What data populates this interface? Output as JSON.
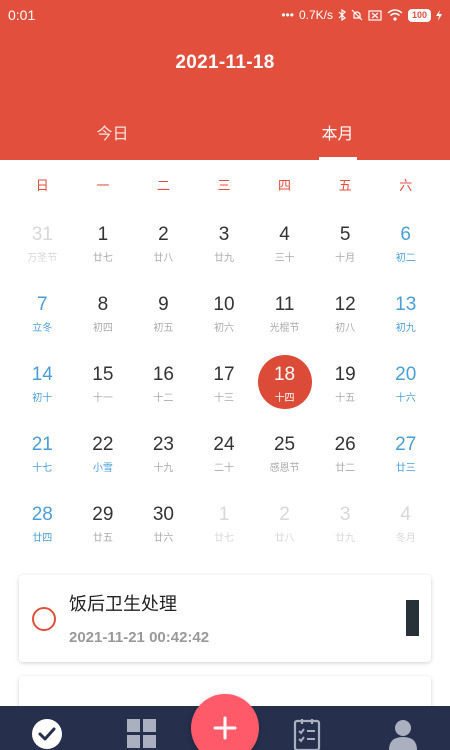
{
  "status_bar": {
    "time": "0:01",
    "network_speed": "0.7K/s",
    "battery": "100"
  },
  "header": {
    "date": "2021-11-18",
    "tabs": [
      {
        "label": "今日",
        "active": false
      },
      {
        "label": "本月",
        "active": true
      }
    ]
  },
  "calendar": {
    "weekdays": [
      "日",
      "一",
      "二",
      "三",
      "四",
      "五",
      "六"
    ],
    "days": [
      {
        "num": "31",
        "sub": "万圣节",
        "kind": "other"
      },
      {
        "num": "1",
        "sub": "廿七",
        "kind": "normal"
      },
      {
        "num": "2",
        "sub": "廿八",
        "kind": "normal"
      },
      {
        "num": "3",
        "sub": "廿九",
        "kind": "normal"
      },
      {
        "num": "4",
        "sub": "三十",
        "kind": "normal"
      },
      {
        "num": "5",
        "sub": "十月",
        "kind": "normal"
      },
      {
        "num": "6",
        "sub": "初二",
        "kind": "weekend"
      },
      {
        "num": "7",
        "sub": "立冬",
        "kind": "weekend"
      },
      {
        "num": "8",
        "sub": "初四",
        "kind": "normal"
      },
      {
        "num": "9",
        "sub": "初五",
        "kind": "normal"
      },
      {
        "num": "10",
        "sub": "初六",
        "kind": "normal"
      },
      {
        "num": "11",
        "sub": "光棍节",
        "kind": "normal"
      },
      {
        "num": "12",
        "sub": "初八",
        "kind": "normal"
      },
      {
        "num": "13",
        "sub": "初九",
        "kind": "weekend"
      },
      {
        "num": "14",
        "sub": "初十",
        "kind": "weekend"
      },
      {
        "num": "15",
        "sub": "十一",
        "kind": "normal"
      },
      {
        "num": "16",
        "sub": "十二",
        "kind": "normal"
      },
      {
        "num": "17",
        "sub": "十三",
        "kind": "normal"
      },
      {
        "num": "18",
        "sub": "十四",
        "kind": "selected"
      },
      {
        "num": "19",
        "sub": "十五",
        "kind": "normal"
      },
      {
        "num": "20",
        "sub": "十六",
        "kind": "weekend"
      },
      {
        "num": "21",
        "sub": "十七",
        "kind": "weekend"
      },
      {
        "num": "22",
        "sub": "小雪",
        "kind": "term"
      },
      {
        "num": "23",
        "sub": "十九",
        "kind": "normal"
      },
      {
        "num": "24",
        "sub": "二十",
        "kind": "normal"
      },
      {
        "num": "25",
        "sub": "感恩节",
        "kind": "normal"
      },
      {
        "num": "26",
        "sub": "廿二",
        "kind": "normal"
      },
      {
        "num": "27",
        "sub": "廿三",
        "kind": "weekend"
      },
      {
        "num": "28",
        "sub": "廿四",
        "kind": "weekend"
      },
      {
        "num": "29",
        "sub": "廿五",
        "kind": "normal"
      },
      {
        "num": "30",
        "sub": "廿六",
        "kind": "normal"
      },
      {
        "num": "1",
        "sub": "廿七",
        "kind": "other"
      },
      {
        "num": "2",
        "sub": "廿八",
        "kind": "other"
      },
      {
        "num": "3",
        "sub": "廿九",
        "kind": "other"
      },
      {
        "num": "4",
        "sub": "冬月",
        "kind": "other"
      }
    ]
  },
  "tasks": [
    {
      "title": "饭后卫生处理",
      "time": "2021-11-21 00:42:42"
    },
    {
      "title": "",
      "time": ""
    }
  ],
  "bottom_nav": {
    "items": [
      {
        "icon": "check-circle-icon"
      },
      {
        "icon": "grid-icon"
      },
      {
        "icon": "plus-icon"
      },
      {
        "icon": "checklist-icon"
      },
      {
        "icon": "person-icon"
      }
    ]
  },
  "colors": {
    "primary": "#e2503d",
    "weekend": "#4a9fd8",
    "nav_bg": "#26304d",
    "fab": "#ff5a6a"
  }
}
